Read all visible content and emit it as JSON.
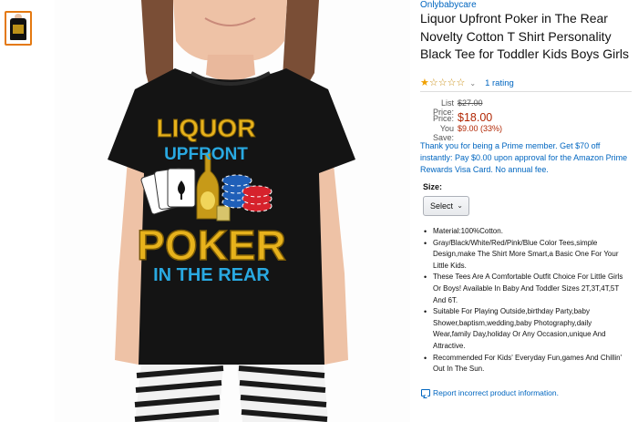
{
  "brand": "Onlybabycare",
  "title": "Liquor Upfront Poker in The Rear Novelty Cotton T Shirt Personality Black Tee for Toddler Kids Boys Girls",
  "rating": {
    "stars": 1,
    "max_stars": 5,
    "link_text": "1 rating"
  },
  "pricing": {
    "list_label": "List Price:",
    "list_value": "$27.00",
    "price_label": "Price:",
    "price_value": "$18.00",
    "save_label": "You Save:",
    "save_value": "$9.00 (33%)"
  },
  "prime_message": "Thank you for being a Prime member. Get $70 off instantly: Pay $0.00 upon approval for the Amazon Prime Rewards Visa Card. No annual fee.",
  "size": {
    "label": "Size:",
    "selected": "Select"
  },
  "bullets": [
    "Material:100%Cotton.",
    "Gray/Black/White/Red/Pink/Blue Color Tees,simple Design,make The Shirt More Smart,a Basic One For Your Little Kids.",
    "These Tees Are A Comfortable Outfit Choice For Little Girls Or Boys! Available In Baby And Toddler Sizes 2T,3T,4T,5T And 6T.",
    "Suitable For Playing Outside,birthday Party,baby Shower,baptism,wedding,baby Photography,daily Wear,family Day,holiday Or Any Occasion,unique And Attractive.",
    "Recommended For Kids' Everyday Fun,games And Chillin' Out In The Sun."
  ],
  "report_link": "Report incorrect product information.",
  "shirt_print": {
    "line1": "LIQUOR",
    "line2": "UPFRONT",
    "line3": "POKER",
    "line4": "IN THE REAR"
  },
  "colors": {
    "link": "#0066c0",
    "price": "#b12704",
    "star": "#f0a000",
    "thumb_border": "#e47911",
    "shirt_yellow": "#e7b21c",
    "shirt_blue": "#29a9e1"
  }
}
